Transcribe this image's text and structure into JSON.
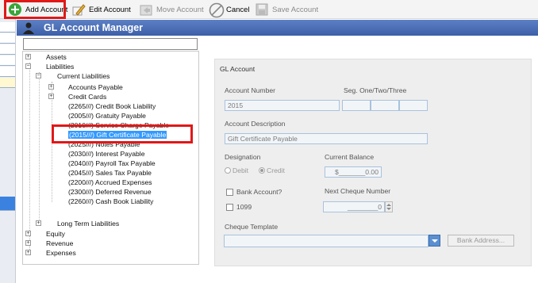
{
  "toolbar": {
    "add_account": "Add Account",
    "edit_account": "Edit Account",
    "move_account": "Move Account",
    "cancel": "Cancel",
    "save_account": "Save Account"
  },
  "window": {
    "title": "GL Account Manager"
  },
  "search": {
    "value": ""
  },
  "tree": {
    "assets": "Assets",
    "liabilities": "Liabilities",
    "current_liabilities": "Current Liabilities",
    "accounts_payable": "Accounts Payable",
    "credit_cards": "Credit Cards",
    "items": [
      "(2265///) Credit Book Liability",
      "(2005///) Gratuity Payable",
      "(2010///) Service Charge Payable",
      "(2015///) Gift Certificate Payable",
      "(2025///) Notes Payable",
      "(2030///) Interest Payable",
      "(2040///) Payroll Tax Payable",
      "(2045///) Sales Tax Payable",
      "(2200///) Accrued Expenses",
      "(2300///) Deferred Revenue",
      "(2260///) Cash Book Liability"
    ],
    "long_term_liabilities": "Long Term Liabilities",
    "equity": "Equity",
    "revenue": "Revenue",
    "expenses": "Expenses"
  },
  "form": {
    "section_title": "GL Account",
    "account_number_label": "Account Number",
    "account_number_value": "2015",
    "seg_label": "Seg. One/Two/Three",
    "description_label": "Account Description",
    "description_value": "Gift Certificate Payable",
    "designation_label": "Designation",
    "debit_label": "Debit",
    "credit_label": "Credit",
    "current_balance_label": "Current Balance",
    "current_balance_value": "$_______0.00",
    "bank_account_label": "Bank Account?",
    "next_cheque_label": "Next Cheque Number",
    "next_cheque_value": "________0",
    "checkbox_1099_label": "1099",
    "cheque_template_label": "Cheque Template",
    "bank_address_button": "Bank Address..."
  },
  "colors": {
    "title_bar": "#3c5fa8",
    "highlight_box": "#e01818",
    "selection": "#3399ff"
  }
}
